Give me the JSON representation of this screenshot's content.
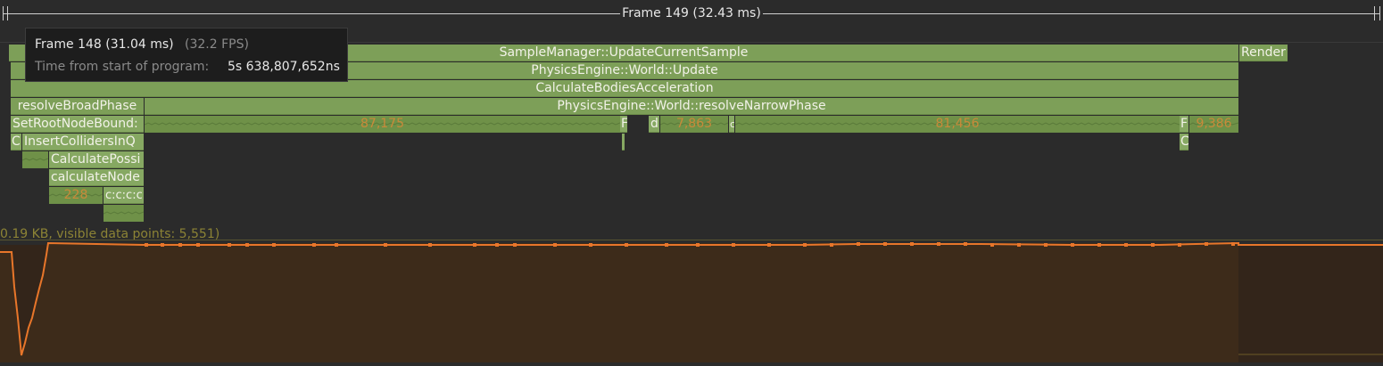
{
  "frame_header": {
    "title": "Frame 149 (32.43 ms)"
  },
  "tooltip": {
    "title": "Frame 148 (31.04 ms)",
    "fps": "(32.2 FPS)",
    "time_label": "Time from start of program:",
    "time_value": "5s 638,807,652ns"
  },
  "zones": {
    "update_current_sample": "SampleManager::UpdateCurrentSample",
    "render": "Render",
    "world_update": "PhysicsEngine::World::Update",
    "calculate_bodies_acceleration": "CalculateBodiesAcceleration",
    "resolve_broad_phase": "resolveBroadPhase",
    "resolve_narrow_phase": "PhysicsEngine::World::resolveNarrowPhase",
    "set_root_node_bounds": "SetRootNodeBound:",
    "count_87175": "87,175",
    "f_label_1": "F",
    "d_label": "d",
    "count_7863": "7,863",
    "c_label_small": "c",
    "count_81456": "81,456",
    "f_label_2": "F",
    "count_9386": "9,386",
    "ci_label": "CI",
    "insert_colliders": "InsertCollidersInQ",
    "c_label_2": "C",
    "calculate_possible": "CalculatePossi",
    "calculate_node": "calculateNode",
    "count_228": "228",
    "ccc_label": "c:c:c:c:"
  },
  "plot": {
    "header": "0.19 KB, visible data points: 5,551)",
    "line_color": "#e8762a",
    "fill_color": "#33251a"
  },
  "colors": {
    "zone_green": "#7d9f58",
    "count_text": "#c98a3a",
    "background": "#2b2b2b"
  }
}
